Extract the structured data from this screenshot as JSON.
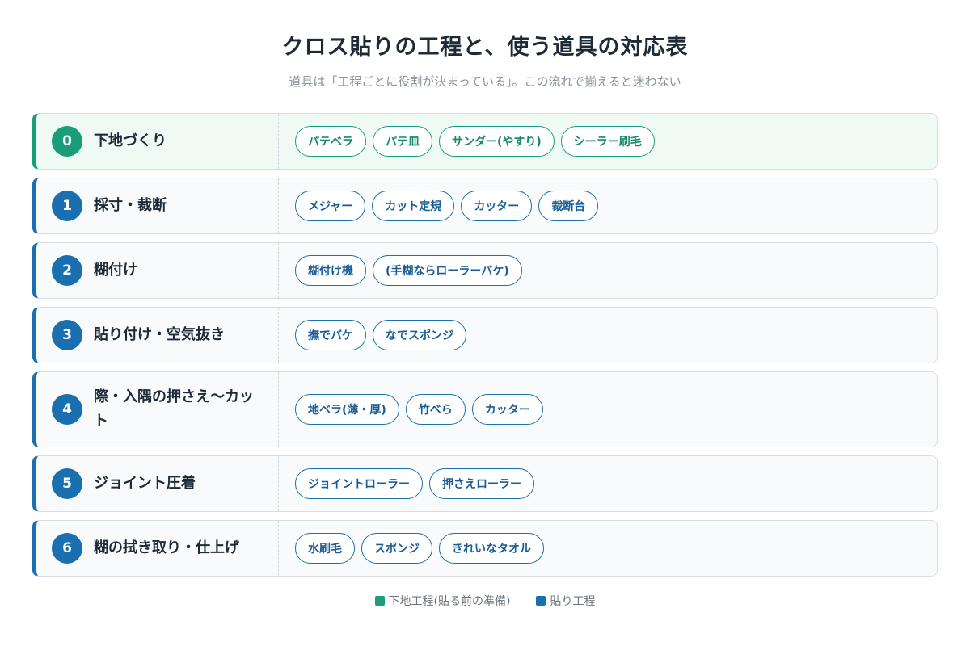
{
  "title": "クロス貼りの工程と、使う道具の対応表",
  "subtitle": "道具は「工程ごとに役割が決まっている」。この流れで揃えると迷わない",
  "colors": {
    "prep": "#1a9e7a",
    "paste": "#1a6fb0"
  },
  "steps": [
    {
      "num": "0",
      "label": "下地づくり",
      "tools": [
        "パテベラ",
        "パテ皿",
        "サンダー(やすり)",
        "シーラー刷毛"
      ]
    },
    {
      "num": "1",
      "label": "採寸・裁断",
      "tools": [
        "メジャー",
        "カット定規",
        "カッター",
        "裁断台"
      ]
    },
    {
      "num": "2",
      "label": "糊付け",
      "tools": [
        "糊付け機",
        "(手糊ならローラーバケ)"
      ]
    },
    {
      "num": "3",
      "label": "貼り付け・空気抜き",
      "tools": [
        "撫でバケ",
        "なでスポンジ"
      ]
    },
    {
      "num": "4",
      "label": "際・入隅の押さえ〜カット",
      "tools": [
        "地ベラ(薄・厚)",
        "竹べら",
        "カッター"
      ]
    },
    {
      "num": "5",
      "label": "ジョイント圧着",
      "tools": [
        "ジョイントローラー",
        "押さえローラー"
      ]
    },
    {
      "num": "6",
      "label": "糊の拭き取り・仕上げ",
      "tools": [
        "水刷毛",
        "スポンジ",
        "きれいなタオル"
      ]
    }
  ],
  "legend": [
    {
      "label": "下地工程(貼る前の準備)",
      "color": "#1a9e7a"
    },
    {
      "label": "貼り工程",
      "color": "#1a6fb0"
    }
  ]
}
